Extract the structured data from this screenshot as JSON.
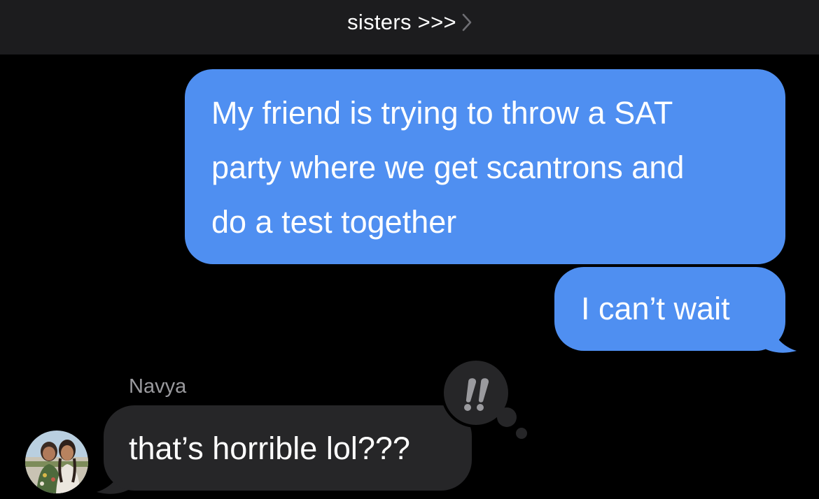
{
  "header": {
    "conversation_title": "sisters >>>",
    "chevron_icon": "chevron-right-icon"
  },
  "messages": [
    {
      "direction": "outgoing",
      "lines": [
        "My friend is trying to throw a SAT",
        "party where we get scantrons and",
        "do a test together"
      ]
    },
    {
      "direction": "outgoing",
      "text": "I can’t wait"
    },
    {
      "direction": "incoming",
      "sender": "Navya",
      "text": "that’s horrible lol???"
    }
  ],
  "reaction": {
    "icon": "double-exclamation-icon",
    "on_message": "that’s horrible lol???"
  },
  "avatar_icon": "contact-photo",
  "colors": {
    "outgoing_bubble": "#4f8ff1",
    "incoming_bubble": "#262628",
    "header_background": "#1c1c1e",
    "background": "#000000",
    "sender_name": "#9a9a9e",
    "tapback_mark": "#9a9a9e"
  }
}
